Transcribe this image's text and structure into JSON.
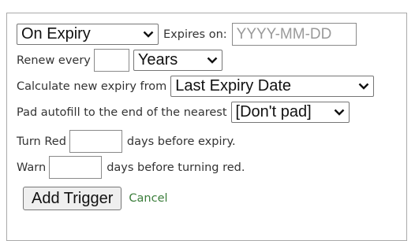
{
  "trigger_form": {
    "trigger_type_select": {
      "selected": "On Expiry"
    },
    "expires_on": {
      "label": "Expires on:",
      "placeholder": "YYYY-MM-DD",
      "value": ""
    },
    "renew": {
      "label": "Renew every",
      "value": "",
      "unit_selected": "Years"
    },
    "calculate_from": {
      "label": "Calculate new expiry from",
      "selected": "Last Expiry Date"
    },
    "pad_autofill": {
      "label": "Pad autofill to the end of the nearest",
      "selected": "[Don't pad]"
    },
    "turn_red": {
      "label_before": "Turn Red",
      "value": "",
      "label_after": "days before expiry."
    },
    "warn": {
      "label_before": "Warn",
      "value": "",
      "label_after": "days before turning red."
    },
    "add_trigger_label": "Add Trigger",
    "cancel_label": "Cancel"
  },
  "icons": {
    "dropdown": "chevron-down-icon"
  },
  "colors": {
    "border": "#aaaaaa",
    "cancel_link": "#3a7d3a",
    "placeholder_text": "#9a9a9a"
  }
}
